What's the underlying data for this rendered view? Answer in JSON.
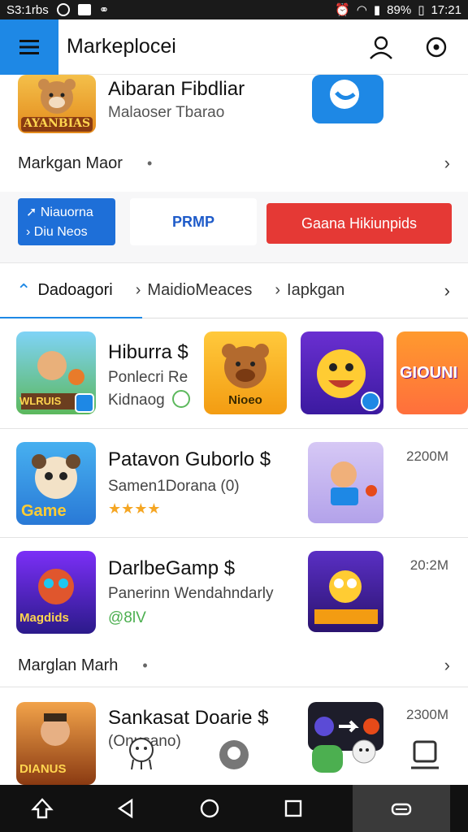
{
  "status": {
    "left_text": "S3:1rbs",
    "battery": "89%",
    "time": "17:21"
  },
  "appbar": {
    "title": "Markeplocei"
  },
  "featured": {
    "title": "Aibaran Fibdliar",
    "subtitle": "Malaoser Tbarao",
    "thumb_text": "AYANBIAS"
  },
  "section1": {
    "title": "Markgan Maor"
  },
  "promo": {
    "left_line1": "Niauorna",
    "left_line2": "Diu Neos",
    "mid": "PRMP",
    "right": "Gaana Hikiunpids"
  },
  "tabs": [
    {
      "label": "Dadoagori"
    },
    {
      "label": "MaidioMeaces"
    },
    {
      "label": "Iapkgan"
    }
  ],
  "rows": [
    {
      "title": "Hiburra $",
      "sub1": "Ponlecri Re",
      "sub2": "Kidnaog",
      "thumb_text": "WLRUIS",
      "icons": [
        "Nioeo",
        "",
        "GIOUNI"
      ]
    },
    {
      "title": "Patavon Guborlo $",
      "sub1": "Samen1Dorana (0)",
      "meta": "2200M",
      "thumb_text": "Game"
    },
    {
      "title": "DarlbeGamp $",
      "sub1": "Panerinn Wendahndarly",
      "sub2": "@8lV",
      "meta": "20:2M",
      "thumb_text": "Magdids"
    },
    {
      "title": "Sankasat Doarie $",
      "sub1": "(Onusano)",
      "meta": "2300M",
      "thumb_text": "DIANUS"
    }
  ],
  "section2": {
    "title": "Marglan Marh"
  },
  "colors": {
    "accent": "#1e88e5",
    "red": "#e53935"
  }
}
